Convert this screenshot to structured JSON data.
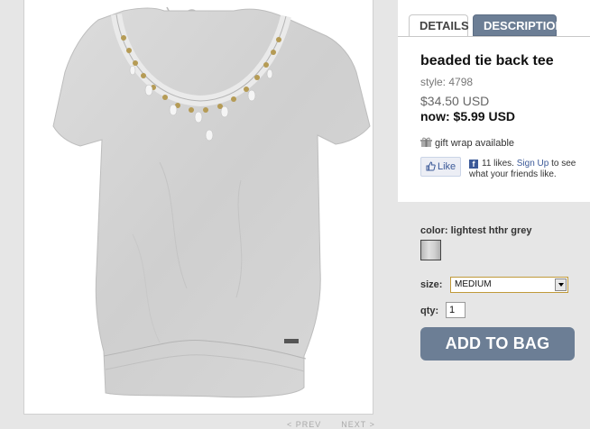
{
  "product": {
    "tabs": [
      {
        "label": "DETAILS",
        "active": true
      },
      {
        "label": "DESCRIPTION",
        "active": false
      }
    ],
    "title": "beaded tie back tee",
    "style_label": "style: 4798",
    "original_price": "$34.50 USD",
    "now_price": "now: $5.99 USD",
    "gift_wrap": "gift wrap available",
    "like_label": "Like",
    "fb_count": "11 likes.",
    "fb_signup": "Sign Up",
    "fb_suffix": "to see what your friends like."
  },
  "options": {
    "color_label": "color: lightest hthr grey",
    "size_label": "size:",
    "size_value": "MEDIUM",
    "qty_label": "qty:",
    "qty_value": "1",
    "add_to_bag": "ADD TO BAG"
  },
  "pager": {
    "prev": "< PREV",
    "next": "NEXT >"
  },
  "colors": {
    "tab_blue": "#6c7e95",
    "fb_blue": "#3b5998",
    "panel_grey": "#e6e6e6"
  },
  "icons": [
    "gift-icon",
    "thumbs-up-icon",
    "facebook-icon",
    "dropdown-arrow-icon"
  ]
}
